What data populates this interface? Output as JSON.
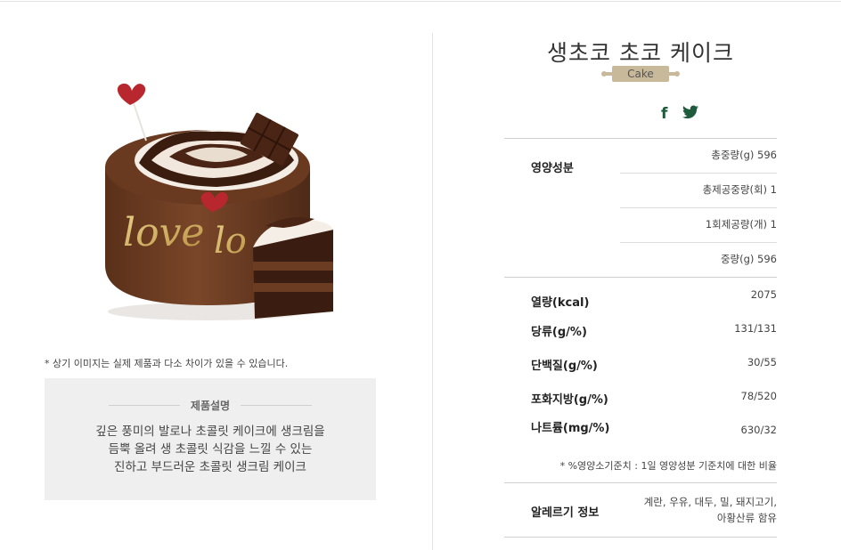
{
  "product": {
    "name": "생초코 초코 케이크",
    "category": "Cake",
    "image_text": "love",
    "disclaimer": "* 상기 이미지는 실제 제품과 다소 차이가 있을 수 있습니다."
  },
  "description": {
    "title": "제품설명",
    "lines": [
      "깊은 풍미의 발로나 초콜릿 케이크에 생크림을",
      "듬뿍 올려 생 초콜릿 식감을 느낄 수 있는",
      "진하고 부드러운 초콜릿 생크림 케이크"
    ]
  },
  "social": {
    "facebook_icon": "f",
    "twitter_icon": "🐦"
  },
  "nutrition": {
    "heading": "영양성분",
    "meta": [
      "총중량(g) 596",
      "총제공중량(회) 1",
      "1회제공량(개) 1",
      "중량(g) 596"
    ],
    "rows": [
      {
        "label": "열량(kcal)",
        "value": "2075"
      },
      {
        "label": "당류(g/%)",
        "value": "131/131"
      },
      {
        "label": "단백질(g/%)",
        "value": "30/55"
      },
      {
        "label": "포화지방(g/%)",
        "value": "78/520"
      },
      {
        "label": "나트륨(mg/%)",
        "value": "630/32"
      }
    ],
    "note": "* %영양소기준치 : 1일 영양성분 기준치에 대한 비율"
  },
  "allergy": {
    "label": "알레르기 정보",
    "lines": [
      "계란, 우유, 대두, 밀, 돼지고기,",
      "아황산류 함유"
    ]
  },
  "colors": {
    "accent_green": "#1e5a3c",
    "ribbon": "#c9b99b",
    "chocolate": "#6b3b22"
  }
}
